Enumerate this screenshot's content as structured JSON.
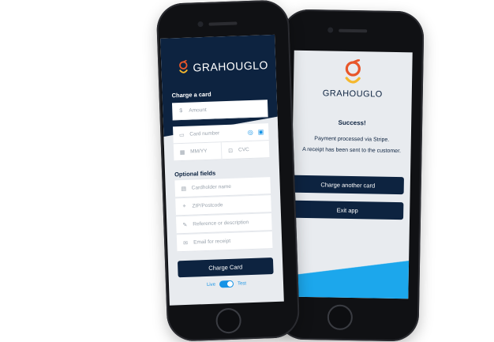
{
  "brand": "GRAHOUGLO",
  "colors": {
    "navy": "#0d2340",
    "accent_blue": "#1593e6",
    "logo_orange": "#e8562a",
    "logo_yellow": "#f5b82e"
  },
  "charge_form": {
    "section_title": "Charge a card",
    "amount_placeholder": "Amount",
    "currency_symbol": "$",
    "card_number_placeholder": "Card number",
    "expiry_placeholder": "MM/YY",
    "cvc_placeholder": "CVC",
    "optional_title": "Optional fields",
    "cardholder_placeholder": "Cardholder name",
    "zip_placeholder": "ZIP/Postcode",
    "reference_placeholder": "Reference or description",
    "email_placeholder": "Email for receipt",
    "charge_button": "Charge Card",
    "mode_live": "Live",
    "mode_test": "Test"
  },
  "success_screen": {
    "title": "Success!",
    "line1": "Payment processed via Stripe.",
    "line2": "A receipt has been sent to the customer.",
    "charge_another_button": "Charge another card",
    "exit_button": "Exit app"
  }
}
